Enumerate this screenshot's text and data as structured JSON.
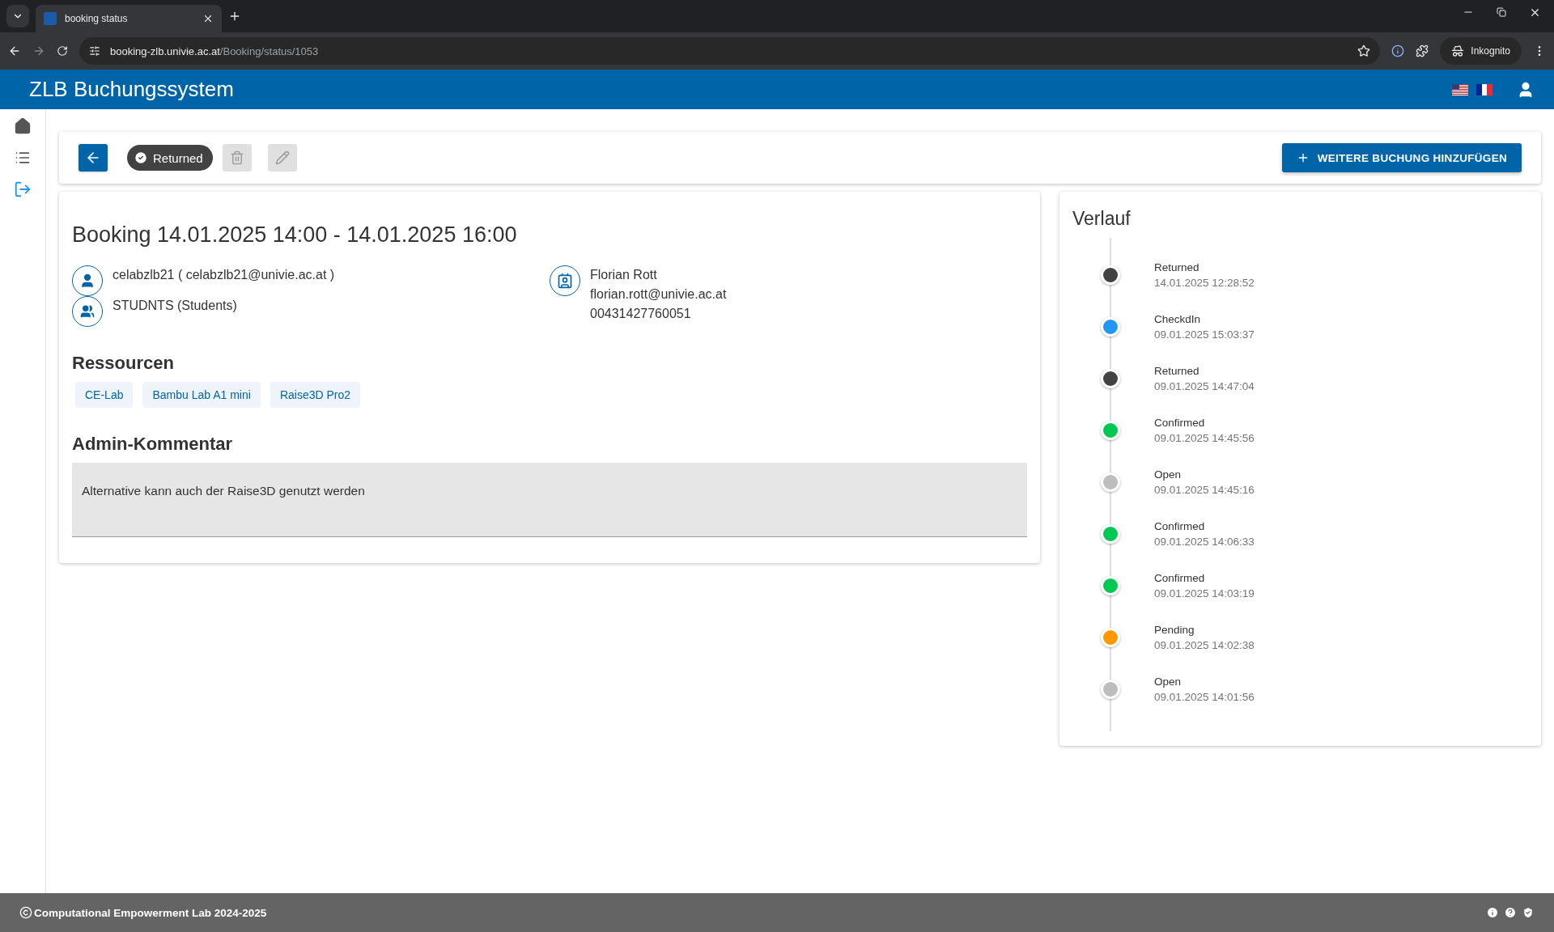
{
  "browser": {
    "tab_title": "booking status",
    "url_host": "booking-zlb.univie.ac.at",
    "url_path": "/Booking/status/1053",
    "profile": "Inkognito"
  },
  "app": {
    "title": "ZLB Buchungssystem"
  },
  "toolbar": {
    "status": "Returned",
    "delete_disabled": true,
    "edit_disabled": true,
    "add_button": "WEITERE BUCHUNG HINZUFÜGEN"
  },
  "booking": {
    "title": "Booking 14.01.2025 14:00 - 14.01.2025 16:00",
    "user": "celabzlb21 ( celabzlb21@univie.ac.at )",
    "group": "STUDNTS (Students)",
    "contact": [
      "Florian Rott",
      "florian.rott@univie.ac.at",
      "00431427760051"
    ],
    "resources_heading": "Ressourcen",
    "resources": [
      "CE-Lab",
      "Bambu Lab A1 mini",
      "Raise3D Pro2"
    ],
    "comment_heading": "Admin-Kommentar",
    "comment": "Alternative kann auch der Raise3D genutzt werden"
  },
  "history": {
    "title": "Verlauf",
    "entries": [
      {
        "status": "Returned",
        "time": "14.01.2025 12:28:52",
        "color": "#424242"
      },
      {
        "status": "CheckdIn",
        "time": "09.01.2025 15:03:37",
        "color": "#2196f3"
      },
      {
        "status": "Returned",
        "time": "09.01.2025 14:47:04",
        "color": "#424242"
      },
      {
        "status": "Confirmed",
        "time": "09.01.2025 14:45:56",
        "color": "#00c853"
      },
      {
        "status": "Open",
        "time": "09.01.2025 14:45:16",
        "color": "#bdbdbd"
      },
      {
        "status": "Confirmed",
        "time": "09.01.2025 14:06:33",
        "color": "#00c853"
      },
      {
        "status": "Confirmed",
        "time": "09.01.2025 14:03:19",
        "color": "#00c853"
      },
      {
        "status": "Pending",
        "time": "09.01.2025 14:02:38",
        "color": "#ff9800"
      },
      {
        "status": "Open",
        "time": "09.01.2025 14:01:56",
        "color": "#bdbdbd"
      }
    ]
  },
  "footer": {
    "text": "Computational Empowerment Lab 2024-2025"
  }
}
